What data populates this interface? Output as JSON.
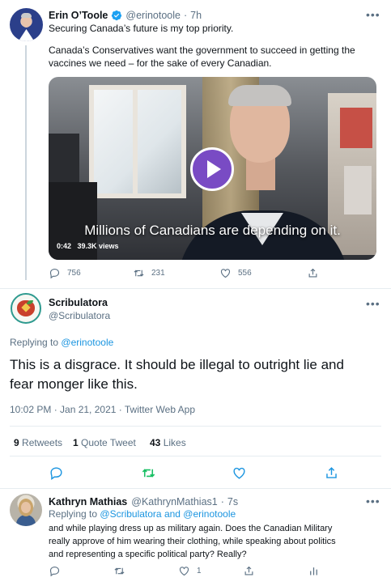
{
  "tweet1": {
    "name": "Erin O’Toole",
    "handle": "@erinotoole",
    "separator": "·",
    "time": "7h",
    "more": "•••",
    "line1": "Securing Canada’s future is my top priority.",
    "line2": "Canada’s Conservatives want the government to succeed in getting the",
    "line3": "vaccines we need – for the sake of every Canadian.",
    "video": {
      "caption": "Millions of Canadians are depending on it.",
      "duration": "0:42",
      "views": "39.3K views"
    },
    "replies": "756",
    "retweets": "231",
    "likes": "556"
  },
  "main": {
    "name": "Scribulatora",
    "handle": "@Scribulatora",
    "more": "•••",
    "replying_prefix": "Replying to",
    "replying_to": "@erinotoole",
    "text_line1": "This is a disgrace. It should be illegal to outright lie and",
    "text_line2": "fear monger like this.",
    "timestamp": "10:02 PM · Jan 21, 2021 · Twitter Web App",
    "retweet_count": "9",
    "retweet_label": "Retweets",
    "quote_count": "1",
    "quote_label": "Quote Tweet",
    "like_count": "43",
    "like_label": "Likes"
  },
  "reply": {
    "name": "Kathryn Mathias",
    "handle": "@KathrynMathias1",
    "separator": "·",
    "time": "7s",
    "more": "•••",
    "replying_prefix": "Replying to",
    "replying_to": "@Scribulatora and @erinotoole",
    "line1": "and while playing dress up as military again. Does the Canadian Military",
    "line2": "really approve of him wearing their clothing, while speaking about politics",
    "line3": "and representing a specific political party? Really?",
    "likes": "1"
  },
  "colors": {
    "accent": "#1b95e0",
    "retweet_active": "#17bf63",
    "secondary_text": "#5b7083",
    "play_button": "#794bc4"
  }
}
